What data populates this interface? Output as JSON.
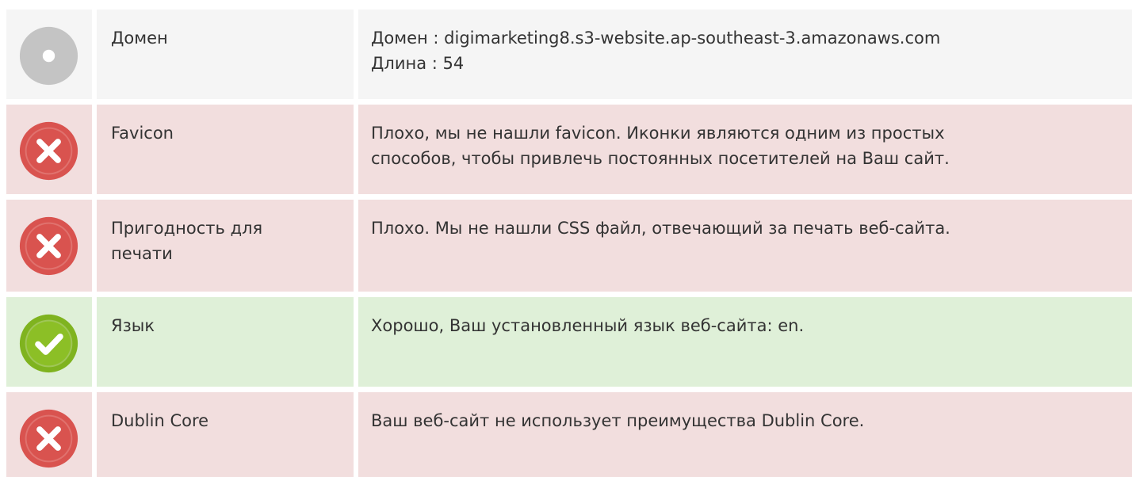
{
  "colors": {
    "neutral": "#f5f5f5",
    "bad": "#f2dede",
    "good": "#dff0d8",
    "bad_icon": "#d9534f",
    "good_icon": "#8cbf26",
    "neutral_icon": "#c4c4c4"
  },
  "rows": [
    {
      "status": "neutral",
      "icon": "info-dot-icon",
      "label": "Домен",
      "value": "Домен : digimarketing8.s3-website.ap-southeast-3.amazonaws.com\nДлина : 54"
    },
    {
      "status": "bad",
      "icon": "error-x-icon",
      "label": "Favicon",
      "value": "Плохо, мы не нашли favicon. Иконки являются одним из простых\nспособов, чтобы привлечь постоянных посетителей на Ваш сайт."
    },
    {
      "status": "bad",
      "icon": "error-x-icon",
      "label": "Пригодность для\nпечати",
      "value": "Плохо. Мы не нашли CSS файл, отвечающий за печать веб-сайта."
    },
    {
      "status": "good",
      "icon": "check-icon",
      "label": "Язык",
      "value": "Хорошо, Ваш установленный язык веб-сайта: en."
    },
    {
      "status": "bad",
      "icon": "error-x-icon",
      "label": "Dublin Core",
      "value": "Ваш веб-сайт не использует преимущества Dublin Core."
    }
  ]
}
